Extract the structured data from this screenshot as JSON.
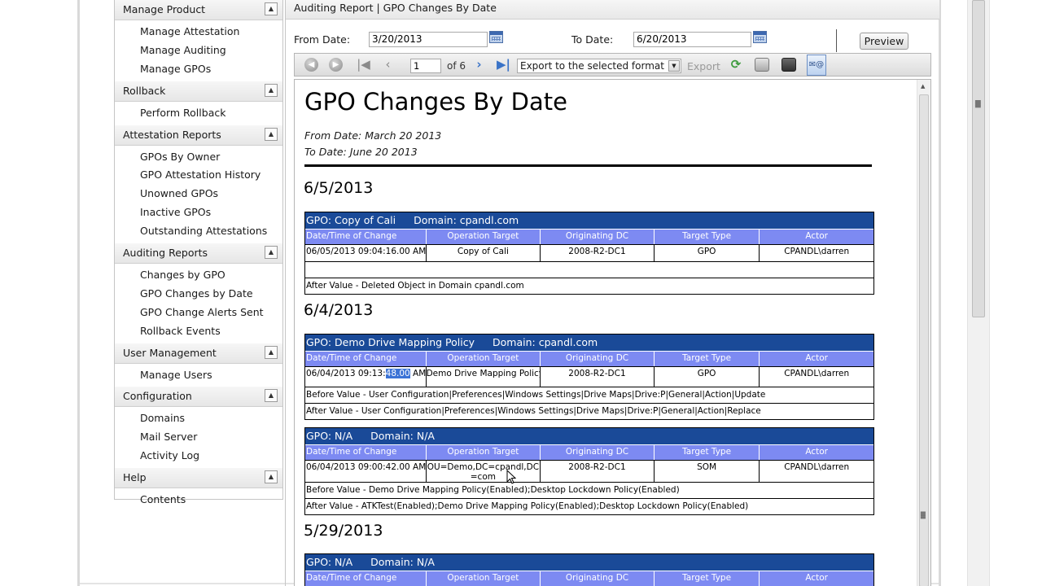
{
  "sidebar": {
    "groups": [
      {
        "title": "Manage Product",
        "items": [
          "Manage Attestation",
          "Manage Auditing",
          "Manage GPOs"
        ]
      },
      {
        "title": "Rollback",
        "items": [
          "Perform Rollback"
        ]
      },
      {
        "title": "Attestation Reports",
        "items": [
          "GPOs By Owner",
          "GPO Attestation History",
          "Unowned GPOs",
          "Inactive GPOs",
          "Outstanding Attestations"
        ]
      },
      {
        "title": "Auditing Reports",
        "items": [
          "Changes by GPO",
          "GPO Changes by Date",
          "GPO Change Alerts Sent",
          "Rollback Events"
        ]
      },
      {
        "title": "User Management",
        "items": [
          "Manage Users"
        ]
      },
      {
        "title": "Configuration",
        "items": [
          "Domains",
          "Mail Server",
          "Activity Log"
        ]
      },
      {
        "title": "Help",
        "items": [
          "Contents"
        ]
      }
    ]
  },
  "main": {
    "breadcrumb": "Auditing Report | GPO Changes By Date",
    "from_label": "From Date:",
    "from_value": "3/20/2013",
    "to_label": "To Date:",
    "to_value": "6/20/2013",
    "preview_label": "Preview"
  },
  "toolbar": {
    "page_value": "1",
    "page_of": "of 6",
    "export_format": "Export to the selected format",
    "export_label": "Export"
  },
  "report": {
    "title": "GPO Changes By Date",
    "from_line": "From Date: March 20 2013",
    "to_line": "To Date: June 20 2013",
    "columns": [
      "Date/Time of Change",
      "Operation Target",
      "Originating DC",
      "Target Type",
      "Actor"
    ],
    "sections": [
      {
        "date": "6/5/2013",
        "blocks": [
          {
            "gpo": "GPO: Copy of Cali",
            "domain": "Domain: cpandl.com",
            "row": [
              "06/05/2013 09:04:16.00 AM",
              "Copy of Cali",
              "2008-R2-DC1",
              "GPO",
              "CPANDL\\darren"
            ],
            "before": "",
            "after": "After Value - Deleted Object in Domain cpandl.com"
          }
        ]
      },
      {
        "date": "6/4/2013",
        "blocks": [
          {
            "gpo": "GPO: Demo Drive Mapping Policy",
            "domain": "Domain: cpandl.com",
            "row_time_prefix": "06/04/2013 09:13:",
            "row_time_highlight": "48.00",
            "row_time_suffix": " AM",
            "row": [
              "06/04/2013 09:13:48.00 AM",
              "Demo Drive Mapping Policy",
              "2008-R2-DC1",
              "GPO",
              "CPANDL\\darren"
            ],
            "before": "Before Value - User Configuration|Preferences|Windows Settings|Drive Maps|Drive:P|General|Action|Update",
            "after": "After Value - User Configuration|Preferences|Windows Settings|Drive Maps|Drive:P|General|Action|Replace"
          },
          {
            "gpo": "GPO: N/A",
            "domain": "Domain: N/A",
            "row": [
              "06/04/2013 09:00:42.00 AM",
              "OU=Demo,DC=cpandl,DC=com",
              "2008-R2-DC1",
              "SOM",
              "CPANDL\\darren"
            ],
            "before": "Before Value - Demo Drive Mapping Policy(Enabled);Desktop Lockdown Policy(Enabled)",
            "after": "After Value - ATKTest(Enabled);Demo Drive Mapping Policy(Enabled);Desktop Lockdown Policy(Enabled)"
          }
        ]
      },
      {
        "date": "5/29/2013",
        "blocks": [
          {
            "gpo": "GPO: N/A",
            "domain": "Domain: N/A"
          }
        ]
      }
    ]
  }
}
